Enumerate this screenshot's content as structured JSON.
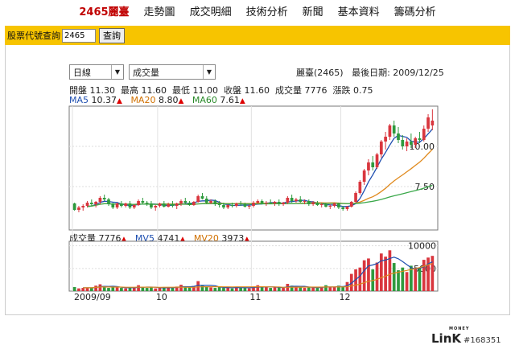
{
  "nav": {
    "items": [
      "2465麗臺",
      "走勢圖",
      "成交明細",
      "技術分析",
      "新聞",
      "基本資料",
      "籌碼分析"
    ]
  },
  "search": {
    "label": "股票代號查詢",
    "value": "2465",
    "button": "查詢"
  },
  "controls": {
    "period": "日線",
    "indicator": "成交量"
  },
  "header": {
    "stock": "麗臺(2465)",
    "last_date_label": "最後日期:",
    "last_date": "2009/12/25"
  },
  "quote": {
    "open_label": "開盤",
    "open": "11.30",
    "high_label": "最高",
    "high": "11.60",
    "low_label": "最低",
    "low": "11.00",
    "close_label": "收盤",
    "close": "11.60",
    "vol_label": "成交量",
    "vol": "7776",
    "chg_label": "漲跌",
    "chg": "0.75"
  },
  "ma": {
    "ma5_label": "MA5",
    "ma5": "10.37",
    "ma20_label": "MA20",
    "ma20": "8.80",
    "ma60_label": "MA60",
    "ma60": "7.61"
  },
  "vol_legend": {
    "vol_label": "成交量",
    "vol": "7776",
    "mv5_label": "MV5",
    "mv5": "4741",
    "mv20_label": "MV20",
    "mv20": "3973"
  },
  "colors": {
    "up": "#d9363e",
    "down": "#2e9a3e",
    "ma5": "#1f4fb0",
    "ma20": "#e08a1e",
    "ma60": "#3aa84a"
  },
  "chart_data": {
    "type": "candlestick",
    "price_ticks": [
      7.5,
      10.0
    ],
    "price_tick_labels": [
      "7.50",
      "10.00"
    ],
    "ylim": [
      4.8,
      12.5
    ],
    "volume_ticks": [
      5000,
      10000
    ],
    "volume_tick_labels": [
      "5000",
      "10000"
    ],
    "volume_ylim": [
      0,
      11000
    ],
    "month_labels": [
      {
        "label": "2009/09",
        "index": 0
      },
      {
        "label": "10",
        "index": 20
      },
      {
        "label": "11",
        "index": 42
      },
      {
        "label": "12",
        "index": 63
      }
    ],
    "candles": [
      [
        6.45,
        6.5,
        6.0,
        6.05
      ],
      [
        6.05,
        6.3,
        5.9,
        6.2
      ],
      [
        6.2,
        6.4,
        6.0,
        6.3
      ],
      [
        6.3,
        6.6,
        6.2,
        6.5
      ],
      [
        6.5,
        6.7,
        6.3,
        6.4
      ],
      [
        6.4,
        6.6,
        6.2,
        6.55
      ],
      [
        6.55,
        6.9,
        6.4,
        6.8
      ],
      [
        6.8,
        7.0,
        6.6,
        6.7
      ],
      [
        6.7,
        6.8,
        6.3,
        6.4
      ],
      [
        6.4,
        6.5,
        6.1,
        6.2
      ],
      [
        6.2,
        6.5,
        6.1,
        6.45
      ],
      [
        6.45,
        6.6,
        6.2,
        6.3
      ],
      [
        6.3,
        6.5,
        6.2,
        6.45
      ],
      [
        6.45,
        6.6,
        6.1,
        6.2
      ],
      [
        6.2,
        6.4,
        6.1,
        6.35
      ],
      [
        6.35,
        6.7,
        6.3,
        6.6
      ],
      [
        6.6,
        6.8,
        6.4,
        6.5
      ],
      [
        6.5,
        6.6,
        6.3,
        6.45
      ],
      [
        6.45,
        6.6,
        6.1,
        6.2
      ],
      [
        6.2,
        6.35,
        6.0,
        6.3
      ],
      [
        6.3,
        6.5,
        6.2,
        6.45
      ],
      [
        6.45,
        6.6,
        6.2,
        6.25
      ],
      [
        6.25,
        6.5,
        6.2,
        6.4
      ],
      [
        6.4,
        6.6,
        6.2,
        6.3
      ],
      [
        6.3,
        6.5,
        6.1,
        6.45
      ],
      [
        6.45,
        6.7,
        6.3,
        6.6
      ],
      [
        6.6,
        6.8,
        6.4,
        6.5
      ],
      [
        6.5,
        6.6,
        6.3,
        6.35
      ],
      [
        6.35,
        6.6,
        6.3,
        6.55
      ],
      [
        6.55,
        7.0,
        6.5,
        6.9
      ],
      [
        6.9,
        7.1,
        6.7,
        6.75
      ],
      [
        6.75,
        6.9,
        6.4,
        6.5
      ],
      [
        6.5,
        6.7,
        6.4,
        6.6
      ],
      [
        6.6,
        6.7,
        6.3,
        6.4
      ],
      [
        6.4,
        6.6,
        6.2,
        6.35
      ],
      [
        6.35,
        6.5,
        6.1,
        6.2
      ],
      [
        6.2,
        6.4,
        6.1,
        6.35
      ],
      [
        6.35,
        6.5,
        6.2,
        6.3
      ],
      [
        6.3,
        6.5,
        6.2,
        6.45
      ],
      [
        6.45,
        6.6,
        6.3,
        6.4
      ],
      [
        6.4,
        6.5,
        6.2,
        6.25
      ],
      [
        6.25,
        6.4,
        6.1,
        6.3
      ],
      [
        6.3,
        6.6,
        6.2,
        6.5
      ],
      [
        6.5,
        6.7,
        6.4,
        6.6
      ],
      [
        6.6,
        6.7,
        6.4,
        6.45
      ],
      [
        6.45,
        6.6,
        6.3,
        6.5
      ],
      [
        6.5,
        6.7,
        6.4,
        6.45
      ],
      [
        6.45,
        6.6,
        6.3,
        6.55
      ],
      [
        6.55,
        6.7,
        6.3,
        6.4
      ],
      [
        6.4,
        6.55,
        6.3,
        6.5
      ],
      [
        6.5,
        6.9,
        6.4,
        6.8
      ],
      [
        6.8,
        7.0,
        6.5,
        6.6
      ],
      [
        6.6,
        6.8,
        6.5,
        6.7
      ],
      [
        6.7,
        6.9,
        6.5,
        6.55
      ],
      [
        6.55,
        6.7,
        6.4,
        6.6
      ],
      [
        6.6,
        6.7,
        6.3,
        6.4
      ],
      [
        6.4,
        6.6,
        6.3,
        6.5
      ],
      [
        6.5,
        6.6,
        6.3,
        6.35
      ],
      [
        6.35,
        6.5,
        6.2,
        6.4
      ],
      [
        6.4,
        6.5,
        6.2,
        6.25
      ],
      [
        6.25,
        6.4,
        6.1,
        6.3
      ],
      [
        6.3,
        6.5,
        6.2,
        6.45
      ],
      [
        6.45,
        6.5,
        6.1,
        6.2
      ],
      [
        6.2,
        6.3,
        6.0,
        6.1
      ],
      [
        6.1,
        6.3,
        6.0,
        6.25
      ],
      [
        6.25,
        6.6,
        6.2,
        6.55
      ],
      [
        6.55,
        7.2,
        6.5,
        7.1
      ],
      [
        7.1,
        7.9,
        7.0,
        7.8
      ],
      [
        7.8,
        8.6,
        7.6,
        8.5
      ],
      [
        8.5,
        9.2,
        8.2,
        9.0
      ],
      [
        9.0,
        9.4,
        8.5,
        8.7
      ],
      [
        8.7,
        9.6,
        8.6,
        9.5
      ],
      [
        9.5,
        10.4,
        9.3,
        10.3
      ],
      [
        10.3,
        10.9,
        9.8,
        10.6
      ],
      [
        10.6,
        11.4,
        10.4,
        11.3
      ],
      [
        11.3,
        11.6,
        10.6,
        10.8
      ],
      [
        10.8,
        11.2,
        10.2,
        10.4
      ],
      [
        10.4,
        10.7,
        9.8,
        10.0
      ],
      [
        10.0,
        10.5,
        9.7,
        10.3
      ],
      [
        10.3,
        10.8,
        9.9,
        10.1
      ],
      [
        10.1,
        10.6,
        9.9,
        10.5
      ],
      [
        10.5,
        10.9,
        10.2,
        10.4
      ],
      [
        10.4,
        11.3,
        10.3,
        11.1
      ],
      [
        11.1,
        12.0,
        10.9,
        11.8
      ],
      [
        11.3,
        12.3,
        11.0,
        11.6
      ]
    ],
    "volumes": [
      900,
      600,
      700,
      800,
      650,
      1200,
      1500,
      1100,
      700,
      800,
      900,
      700,
      600,
      800,
      700,
      1300,
      900,
      700,
      800,
      600,
      700,
      800,
      900,
      700,
      1000,
      1400,
      900,
      800,
      1100,
      2200,
      1300,
      900,
      800,
      700,
      900,
      700,
      800,
      600,
      900,
      800,
      700,
      600,
      1000,
      1300,
      800,
      900,
      700,
      800,
      900,
      700,
      1600,
      1200,
      900,
      800,
      700,
      900,
      800,
      700,
      900,
      1300,
      800,
      900,
      1200,
      900,
      2000,
      3800,
      4800,
      5200,
      6800,
      7200,
      4800,
      6300,
      8300,
      7600,
      9000,
      6200,
      4600,
      5200,
      4200,
      5600,
      5000,
      5200,
      6900,
      7400,
      7776
    ]
  }
}
